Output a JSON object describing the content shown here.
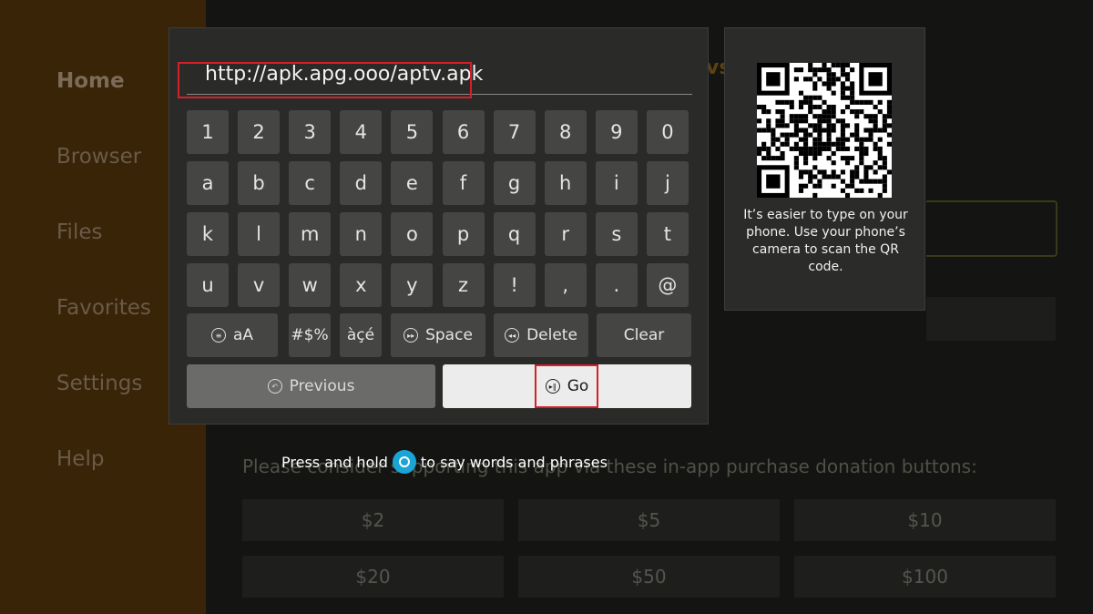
{
  "sidebar": {
    "items": [
      {
        "label": "Home"
      },
      {
        "label": "Browser"
      },
      {
        "label": "Files"
      },
      {
        "label": "Favorites"
      },
      {
        "label": "Settings"
      },
      {
        "label": "Help"
      }
    ]
  },
  "background": {
    "heading_fragment": "vs",
    "donation_text": "Please consider supporting this app via these in-app purchase donation buttons:",
    "donation_buttons": [
      "$2",
      "$5",
      "$10",
      "$20",
      "$50",
      "$100"
    ]
  },
  "keyboard": {
    "url_value": "http://apk.apg.ooo/aptv.apk",
    "rows": [
      [
        "1",
        "2",
        "3",
        "4",
        "5",
        "6",
        "7",
        "8",
        "9",
        "0"
      ],
      [
        "a",
        "b",
        "c",
        "d",
        "e",
        "f",
        "g",
        "h",
        "i",
        "j"
      ],
      [
        "k",
        "l",
        "m",
        "n",
        "o",
        "p",
        "q",
        "r",
        "s",
        "t"
      ],
      [
        "u",
        "v",
        "w",
        "x",
        "y",
        "z",
        "!",
        ",",
        ".",
        "@"
      ]
    ],
    "function_keys": {
      "case": "aA",
      "symbols": "#$%",
      "accents": "àçé",
      "space": "Space",
      "delete": "Delete",
      "clear": "Clear"
    },
    "previous_label": "Previous",
    "go_label": "Go"
  },
  "qr_panel": {
    "caption": "It’s easier to type on your phone. Use your phone’s camera to scan the QR code."
  },
  "voice_hint": {
    "before": "Press and hold",
    "after": "to say words and phrases"
  },
  "colors": {
    "highlight": "#d5202a",
    "alexa": "#1aa5d6"
  }
}
